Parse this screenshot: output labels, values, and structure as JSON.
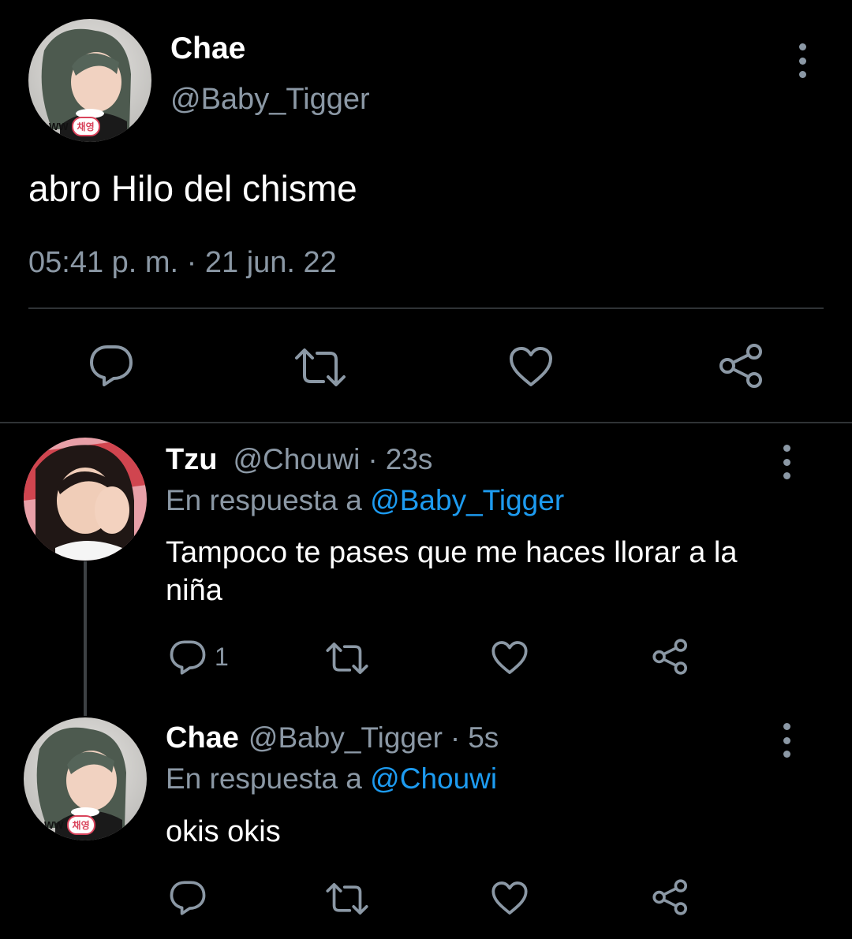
{
  "main_tweet": {
    "display_name": "Chae",
    "handle": "@Baby_Tigger",
    "text": "abro Hilo del chisme",
    "timestamp": "05:41 p. m. · 21 jun. 22",
    "avatar_badge": "채영",
    "avatar_badge_prefix": "WW",
    "actions": [
      "reply-icon",
      "retweet-icon",
      "like-icon",
      "share-icon"
    ]
  },
  "replies": [
    {
      "display_name": "Tzu",
      "handle": "@Chouwi",
      "separator": "·",
      "time": "23s",
      "in_reply_prefix": "En respuesta a",
      "in_reply_to": "@Baby_Tigger",
      "text": "Tampoco te pases que me haces llorar a la niña",
      "reply_count": "1"
    },
    {
      "display_name": "Chae",
      "handle": "@Baby_Tigger",
      "separator": "·",
      "time": "5s",
      "in_reply_prefix": "En respuesta a",
      "in_reply_to": "@Chouwi",
      "text": "okis okis",
      "reply_count": "",
      "avatar_badge": "채영",
      "avatar_badge_prefix": "WW"
    }
  ],
  "colors": {
    "background": "#000000",
    "secondary_text": "#8b98a5",
    "link": "#1d9bf0",
    "divider": "#2f3336"
  }
}
